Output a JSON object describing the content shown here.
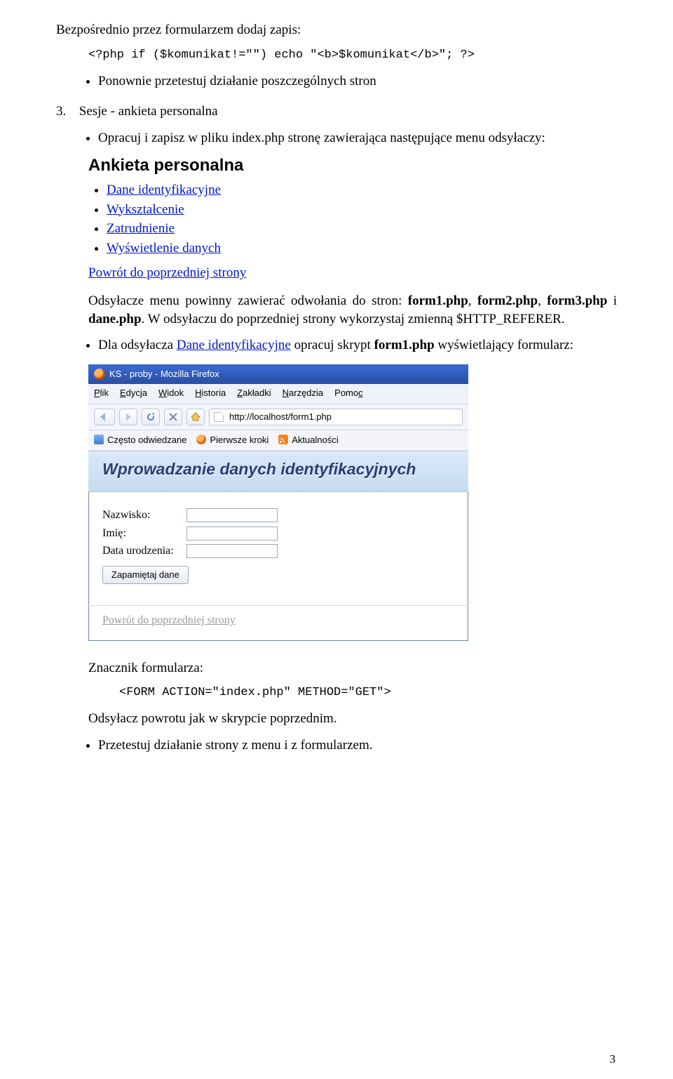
{
  "para_intro": "Bezpośrednio przez formularzem dodaj zapis:",
  "code1": "<?php if ($komunikat!=\"\") echo \"<b>$komunikat</b>\"; ?>",
  "bullet_retest": "Ponownie przetestuj działanie poszczególnych stron",
  "section3": {
    "num": "3.",
    "title": "Sesje - ankieta personalna"
  },
  "bullet_opracuj": "Opracuj i zapisz w pliku index.php stronę zawierająca następujące menu odsyłaczy:",
  "menu_heading": "Ankieta personalna",
  "menu_items": [
    "Dane identyfikacyjne",
    "Wykształcenie",
    "Zatrudnienie",
    "Wyświetlenie danych"
  ],
  "back_link_text": "Powrót do poprzedniej strony",
  "para_odnosniki_a": "Odsyłacze menu powinny zawierać odwołania do stron: ",
  "para_odnosniki_b": ", ",
  "para_odnosniki_c": ", ",
  "para_odnosniki_d": " i ",
  "para_odnosniki_e": ". W odsyłaczu do poprzedniej strony wykorzystaj zmienną $HTTP_REFERER.",
  "bold": {
    "f1": "form1.php",
    "f2": "form2.php",
    "f3": "form3.php",
    "dane": "dane.php"
  },
  "bullet_dla": {
    "pre": "Dla odsyłacza ",
    "link": "Dane identyfikacyjne",
    "mid": " opracuj skrypt ",
    "bold": "form1.php",
    "post": " wyświetlający formularz:"
  },
  "ff": {
    "title": "KS - proby - Mozilla Firefox",
    "menus": {
      "plik": "Plik",
      "edycja": "Edycja",
      "widok": "Widok",
      "historia": "Historia",
      "zakladki": "Zakładki",
      "narzedzia": "Narzędzia",
      "pomoc": "Pomoc"
    },
    "url": "http://localhost/form1.php",
    "bookmarks": {
      "a": "Często odwiedzane",
      "b": "Pierwsze kroki",
      "c": "Aktualności"
    },
    "banner": "Wprowadzanie danych identyfikacyjnych",
    "labels": {
      "nazwisko": "Nazwisko:",
      "imie": "Imię:",
      "data": "Data urodzenia:"
    },
    "submit": "Zapamiętaj dane",
    "back": "Powrót do poprzedniej strony"
  },
  "para_znacznik": "Znacznik formularza:",
  "code2": "<FORM ACTION=\"index.php\" METHOD=\"GET\">",
  "para_odsylacz": "Odsyłacz powrotu jak w skrypcie poprzednim.",
  "bullet_przetestuj": "Przetestuj działanie strony z menu i z formularzem.",
  "page_number": "3"
}
